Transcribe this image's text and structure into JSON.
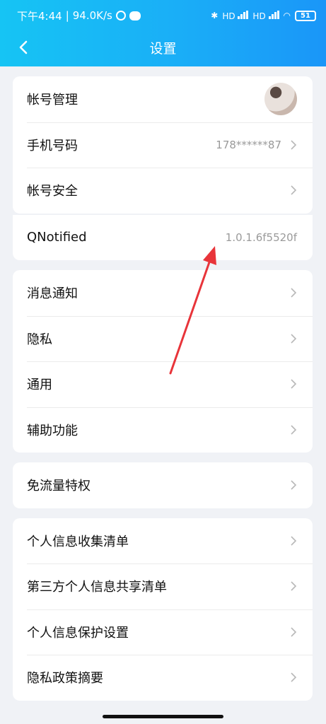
{
  "status_bar": {
    "time": "下午4:44",
    "separator": "|",
    "speed": "94.0K/s",
    "signal1_label": "HD",
    "signal2_label": "HD",
    "battery": "51"
  },
  "nav": {
    "title": "设置"
  },
  "sections": [
    {
      "rows": [
        {
          "label": "帐号管理",
          "value": ""
        },
        {
          "label": "手机号码",
          "value": "178******87"
        },
        {
          "label": "帐号安全",
          "value": ""
        }
      ]
    },
    {
      "rows": [
        {
          "label": "QNotified",
          "value": "1.0.1.6f5520f"
        }
      ]
    },
    {
      "rows": [
        {
          "label": "消息通知",
          "value": ""
        },
        {
          "label": "隐私",
          "value": ""
        },
        {
          "label": "通用",
          "value": ""
        },
        {
          "label": "辅助功能",
          "value": ""
        }
      ]
    },
    {
      "rows": [
        {
          "label": "免流量特权",
          "value": ""
        }
      ]
    },
    {
      "rows": [
        {
          "label": "个人信息收集清单",
          "value": ""
        },
        {
          "label": "第三方个人信息共享清单",
          "value": ""
        },
        {
          "label": "个人信息保护设置",
          "value": ""
        },
        {
          "label": "隐私政策摘要",
          "value": ""
        }
      ]
    }
  ],
  "annotation_color": "#e8343a"
}
